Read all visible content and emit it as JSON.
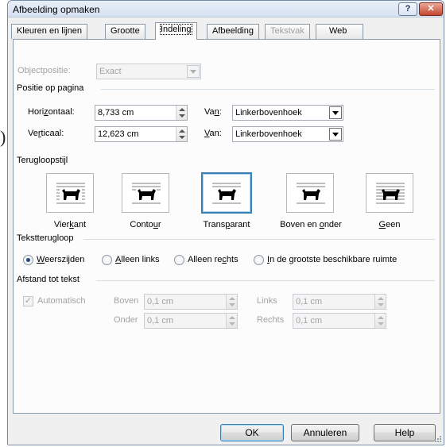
{
  "window": {
    "title": "Afbeelding opmaken",
    "help_button": "?",
    "close_button": "✕"
  },
  "stray_text": ")",
  "tabs": [
    {
      "label": "Kleuren en lijnen",
      "state": "normal"
    },
    {
      "label": "Grootte",
      "state": "normal"
    },
    {
      "label": "Indeling",
      "state": "active"
    },
    {
      "label": "Afbeelding",
      "state": "normal"
    },
    {
      "label": "Tekstvak",
      "state": "disabled"
    },
    {
      "label": "Web",
      "state": "normal"
    }
  ],
  "objectpositie": {
    "label": "Objectpositie:",
    "value": "Exact"
  },
  "positie_op_pagina": {
    "heading": "Positie op pagina",
    "horizontaal": {
      "label_pre": "Hori",
      "label_u": "z",
      "label_post": "ontaal:",
      "value": "8,733 cm",
      "van_label_pre": "Va",
      "van_label_u": "n",
      "van_label_post": ":",
      "van_value": "Linkerbovenhoek"
    },
    "verticaal": {
      "label_pre": "Ve",
      "label_u": "r",
      "label_post": "ticaal:",
      "value": "12,623 cm",
      "van_label_pre": "",
      "van_label_u": "V",
      "van_label_post": "an:",
      "van_value": "Linkerbovenhoek"
    }
  },
  "terugloopstijl": {
    "heading": "Terugloopstijl",
    "options": [
      {
        "pre": "Vier",
        "u": "k",
        "post": "ant",
        "selected": false
      },
      {
        "pre": "Conto",
        "u": "u",
        "post": "r",
        "selected": false
      },
      {
        "pre": "Trans",
        "u": "p",
        "post": "arant",
        "selected": true
      },
      {
        "pre": "Boven en ",
        "u": "o",
        "post": "nder",
        "selected": false
      },
      {
        "pre": "",
        "u": "G",
        "post": "een",
        "selected": false
      }
    ]
  },
  "tekstterugloop": {
    "heading": "Tekstterugloop",
    "options": [
      {
        "pre": "",
        "u": "W",
        "post": "eerszijden",
        "checked": true
      },
      {
        "pre": "",
        "u": "A",
        "post": "lleen links",
        "checked": false
      },
      {
        "pre": "Alleen re",
        "u": "c",
        "post": "hts",
        "checked": false
      },
      {
        "pre": "",
        "u": "I",
        "post": "n de grootste beschikbare ruimte",
        "checked": false
      }
    ]
  },
  "afstand_tot_tekst": {
    "heading": "Afstand tot tekst",
    "automatisch_label": "Automatisch",
    "automatisch_checked": true,
    "boven": {
      "label": "Boven",
      "value": "0,1 cm"
    },
    "onder": {
      "label": "Onder",
      "value": "0,1 cm"
    },
    "links": {
      "label": "Links",
      "value": "0,1 cm"
    },
    "rechts": {
      "label": "Rechts",
      "value": "0,1 cm"
    }
  },
  "buttons": {
    "ok": "OK",
    "annuleren": "Annuleren",
    "help": "Help"
  },
  "colors": {
    "accent": "#3c7fb1",
    "title_bar": "#d6e2f1",
    "close_red": "#c6452e"
  }
}
